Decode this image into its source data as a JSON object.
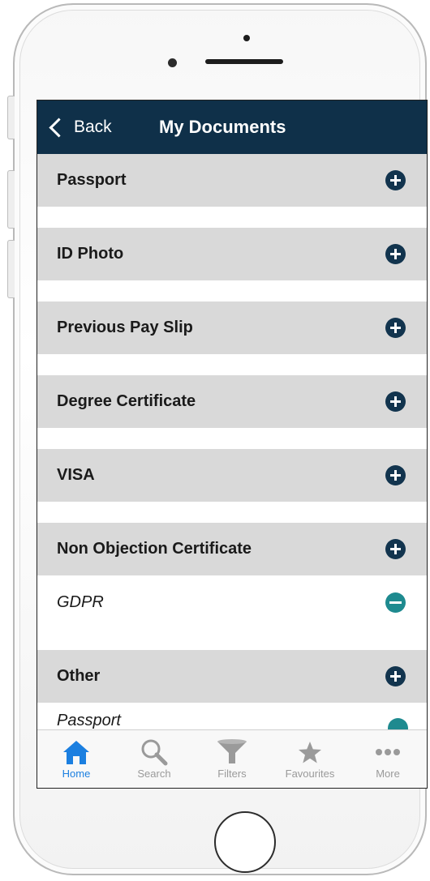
{
  "navbar": {
    "back_label": "Back",
    "title": "My Documents"
  },
  "sections": [
    {
      "label": "Passport"
    },
    {
      "label": "ID Photo"
    },
    {
      "label": "Previous Pay Slip"
    },
    {
      "label": "Degree Certificate"
    },
    {
      "label": "VISA"
    },
    {
      "label": "Non Objection Certificate",
      "items": [
        {
          "label": "GDPR"
        }
      ]
    },
    {
      "label": "Other"
    }
  ],
  "partial_item": {
    "label": "Passport"
  },
  "tabs": [
    {
      "label": "Home",
      "icon": "home-icon",
      "active": true
    },
    {
      "label": "Search",
      "icon": "search-icon"
    },
    {
      "label": "Filters",
      "icon": "filter-icon"
    },
    {
      "label": "Favourites",
      "icon": "star-icon"
    },
    {
      "label": "More",
      "icon": "more-icon"
    }
  ],
  "colors": {
    "navbar": "#0f3049",
    "add_button": "#12344e",
    "remove_button": "#1e8a8f",
    "section_bg": "#d9d9d9",
    "active_tab": "#1b7fe0"
  }
}
